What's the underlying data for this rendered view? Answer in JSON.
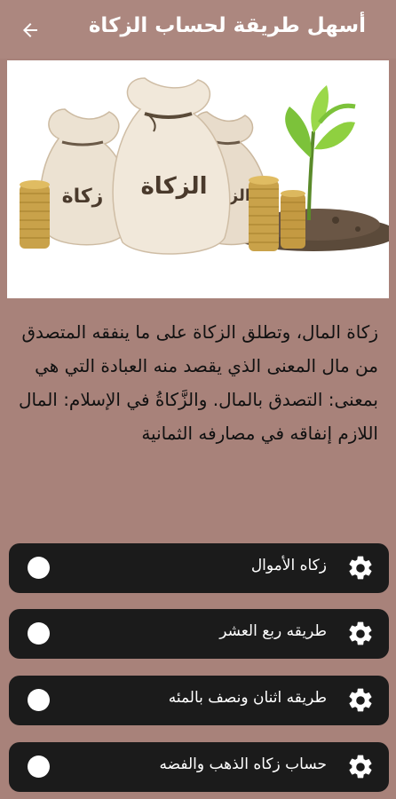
{
  "header": {
    "title": "أسهل طريقة لحساب الزكاة",
    "back_icon": "arrow-left-icon"
  },
  "hero": {
    "bag_left_label": "زكاة",
    "bag_center_label": "الزكاة",
    "bag_right_label": "الز"
  },
  "description": "زكاة المال، وتطلق الزكاة على ما ينفقه المتصدق من مال المعنى الذي يقصد منه العبادة التي هي بمعنى: التصدق بالمال. والزَّكاةُ في الإسلام: المال اللازم إنفاقه في مصارفه الثمانية",
  "menu": {
    "items": [
      {
        "label": "زكاه الأموال",
        "icon": "gear-icon"
      },
      {
        "label": "طريقه ربع العشر",
        "icon": "gear-icon"
      },
      {
        "label": "طريقه اثنان ونصف بالمئه",
        "icon": "gear-icon"
      },
      {
        "label": "حساب زكاه الذهب والفضه",
        "icon": "gear-icon"
      }
    ]
  },
  "colors": {
    "background": "#a8827a",
    "appbar": "#ac877f",
    "item_background": "#1b1b1b",
    "text": "#111111"
  }
}
